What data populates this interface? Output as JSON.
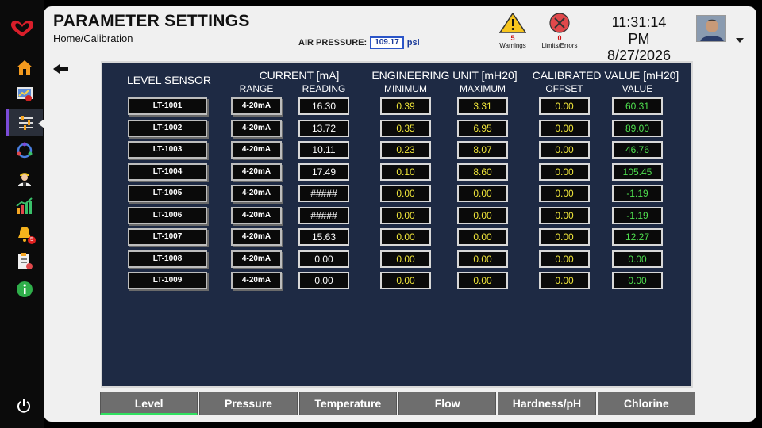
{
  "header": {
    "title": "PARAMETER SETTINGS",
    "breadcrumb": "Home/Calibration",
    "air_pressure_label": "AIR PRESSURE:",
    "air_pressure_value": "109.17",
    "air_pressure_unit": "psi"
  },
  "alerts": {
    "warnings_count": "5",
    "warnings_label": "Warnings",
    "errors_count": "0",
    "errors_label": "Limits/Errors"
  },
  "clock": {
    "time": "11:31:14 PM",
    "date": "8/27/2026"
  },
  "sidebar": {
    "active": "calibration",
    "notification_badge": "5",
    "items": [
      {
        "name": "home-icon"
      },
      {
        "name": "monitor-chart-icon"
      },
      {
        "name": "sliders-icon"
      },
      {
        "name": "cycle-icon"
      },
      {
        "name": "operator-icon"
      },
      {
        "name": "trend-chart-icon"
      },
      {
        "name": "bell-icon"
      },
      {
        "name": "report-icon"
      },
      {
        "name": "info-icon"
      }
    ]
  },
  "table": {
    "headers": {
      "sensor": "LEVEL SENSOR",
      "current": "CURRENT [mA]",
      "range": "RANGE",
      "reading": "READING",
      "eng": "ENGINEERING UNIT [mH20]",
      "min": "MINIMUM",
      "max": "MAXIMUM",
      "cal": "CALIBRATED VALUE [mH20]",
      "offset": "OFFSET",
      "value": "VALUE"
    },
    "rows": [
      {
        "sensor": "LT-1001",
        "range": "4-20mA",
        "reading": "16.30",
        "min": "0.39",
        "max": "3.31",
        "offset": "0.00",
        "value": "60.31"
      },
      {
        "sensor": "LT-1002",
        "range": "4-20mA",
        "reading": "13.72",
        "min": "0.35",
        "max": "6.95",
        "offset": "0.00",
        "value": "89.00"
      },
      {
        "sensor": "LT-1003",
        "range": "4-20mA",
        "reading": "10.11",
        "min": "0.23",
        "max": "8.07",
        "offset": "0.00",
        "value": "46.76"
      },
      {
        "sensor": "LT-1004",
        "range": "4-20mA",
        "reading": "17.49",
        "min": "0.10",
        "max": "8.60",
        "offset": "0.00",
        "value": "105.45"
      },
      {
        "sensor": "LT-1005",
        "range": "4-20mA",
        "reading": "#####",
        "min": "0.00",
        "max": "0.00",
        "offset": "0.00",
        "value": "-1.19"
      },
      {
        "sensor": "LT-1006",
        "range": "4-20mA",
        "reading": "#####",
        "min": "0.00",
        "max": "0.00",
        "offset": "0.00",
        "value": "-1.19"
      },
      {
        "sensor": "LT-1007",
        "range": "4-20mA",
        "reading": "15.63",
        "min": "0.00",
        "max": "0.00",
        "offset": "0.00",
        "value": "12.27"
      },
      {
        "sensor": "LT-1008",
        "range": "4-20mA",
        "reading": "0.00",
        "min": "0.00",
        "max": "0.00",
        "offset": "0.00",
        "value": "0.00"
      },
      {
        "sensor": "LT-1009",
        "range": "4-20mA",
        "reading": "0.00",
        "min": "0.00",
        "max": "0.00",
        "offset": "0.00",
        "value": "0.00"
      }
    ]
  },
  "tabs": [
    {
      "label": "Level",
      "active": true
    },
    {
      "label": "Pressure",
      "active": false
    },
    {
      "label": "Temperature",
      "active": false
    },
    {
      "label": "Flow",
      "active": false
    },
    {
      "label": "Hardness/pH",
      "active": false
    },
    {
      "label": "Chlorine",
      "active": false
    }
  ],
  "colors": {
    "panel_bg": "#1e2a44",
    "engineering_text": "#f0e63a",
    "calibrated_text": "#4fe04f",
    "active_tab_underline": "#30e060"
  }
}
